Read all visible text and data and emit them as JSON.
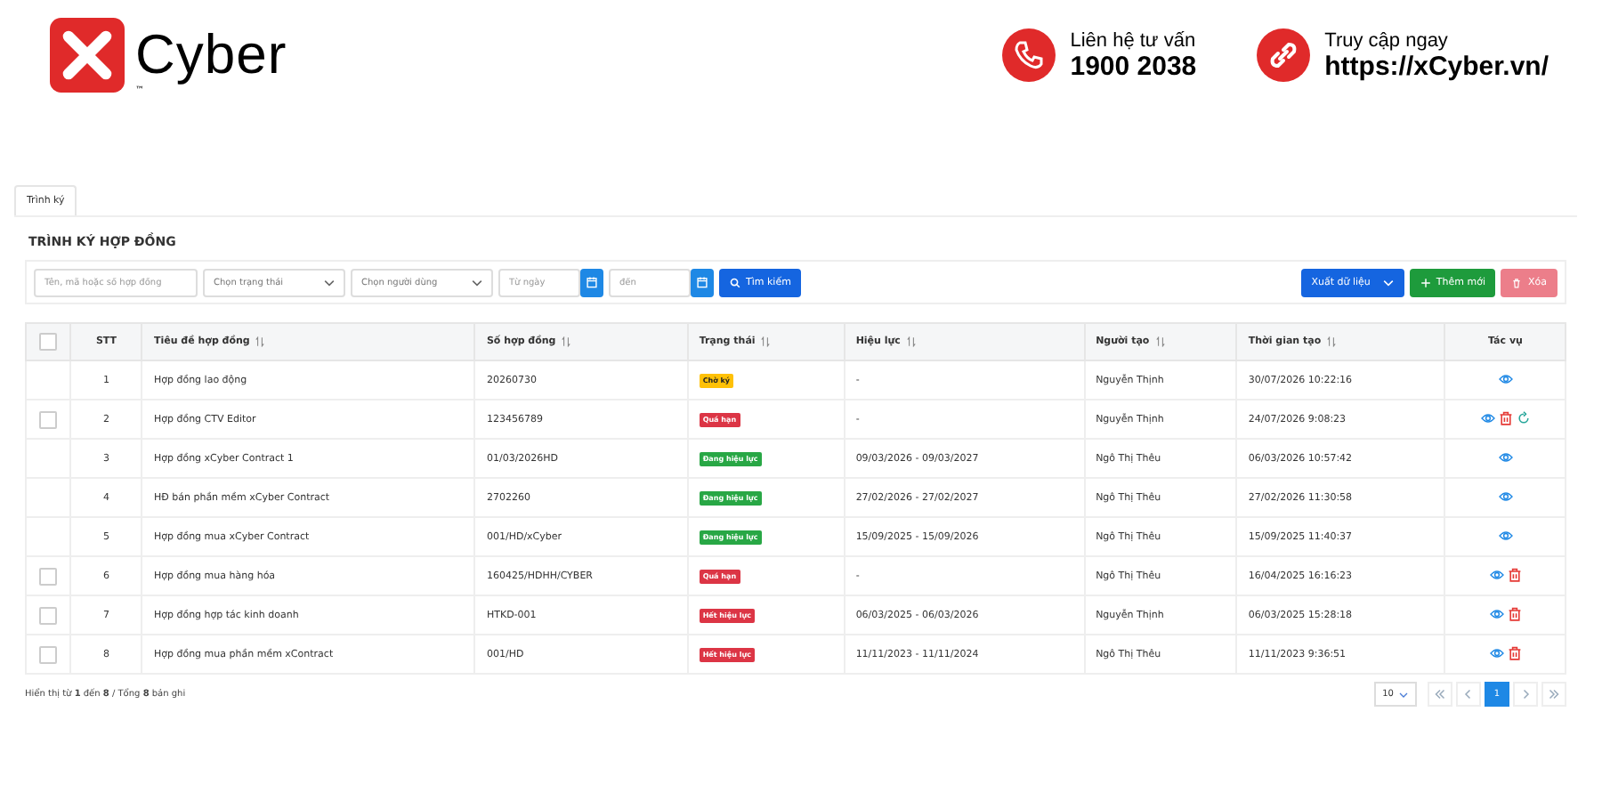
{
  "brand": {
    "name": "Cyber",
    "tm": "™"
  },
  "contacts": [
    {
      "kind": "phone",
      "label": "Liên hệ tư vấn",
      "value": "1900 2038"
    },
    {
      "kind": "link",
      "label": "Truy cập ngay",
      "value": "https://xCyber.vn/"
    }
  ],
  "tabs": [
    {
      "label": "Trình ký",
      "selected": true
    }
  ],
  "page_title": "TRÌNH KÝ HỢP ĐỒNG",
  "filters": {
    "search_placeholder": "Tên, mã hoặc số hợp đồng",
    "status_placeholder": "Chọn trạng thái",
    "user_placeholder": "Chọn người dùng",
    "from_placeholder": "Từ ngày",
    "to_placeholder": "đến",
    "search_button": "Tìm kiếm"
  },
  "toolbar": {
    "export": "Xuất dữ liệu",
    "add": "Thêm mới",
    "delete": "Xóa"
  },
  "table": {
    "select_all_checked": false,
    "columns": [
      {
        "label": "STT",
        "sortable": false
      },
      {
        "label": "Tiêu đề hợp đồng",
        "sortable": true
      },
      {
        "label": "Số hợp đồng",
        "sortable": true
      },
      {
        "label": "Trạng thái",
        "sortable": true
      },
      {
        "label": "Hiệu lực",
        "sortable": true
      },
      {
        "label": "Người tạo",
        "sortable": true
      },
      {
        "label": "Thời gian tạo",
        "sortable": true
      },
      {
        "label": "Tác vụ",
        "sortable": false
      }
    ],
    "rows": [
      {
        "stt": "1",
        "title": "Hợp đồng lao động",
        "number": "20260730",
        "status": "Chờ ký",
        "color": "#ffc107",
        "validity": "-",
        "creator": "Nguyễn Thịnh",
        "created": "30/07/2026 10:22:16",
        "deletable": false,
        "restorable": false
      },
      {
        "checked": false,
        "stt": "2",
        "title": "Hợp đồng CTV Editor",
        "number": "123456789",
        "status": "Quá hạn",
        "color": "#dc3545",
        "validity": "-",
        "creator": "Nguyễn Thịnh",
        "created": "24/07/2026 9:08:23",
        "deletable": true,
        "restorable": true
      },
      {
        "stt": "3",
        "title": "Hợp đồng xCyber Contract 1",
        "number": "01/03/2026HD",
        "status": "Đang hiệu lực",
        "color": "#28a745",
        "validity": "09/03/2026 - 09/03/2027",
        "creator": "Ngô Thị Thêu",
        "created": "06/03/2026 10:57:42",
        "deletable": false,
        "restorable": false
      },
      {
        "stt": "4",
        "title": "HĐ bán phần mềm xCyber Contract",
        "number": "2702260",
        "status": "Đang hiệu lực",
        "color": "#28a745",
        "validity": "27/02/2026 - 27/02/2027",
        "creator": "Ngô Thị Thêu",
        "created": "27/02/2026 11:30:58",
        "deletable": false,
        "restorable": false
      },
      {
        "stt": "5",
        "title": "Hợp đồng mua xCyber Contract",
        "number": "001/HD/xCyber",
        "status": "Đang hiệu lực",
        "color": "#28a745",
        "validity": "15/09/2025 - 15/09/2026",
        "creator": "Ngô Thị Thêu",
        "created": "15/09/2025 11:40:37",
        "deletable": false,
        "restorable": false
      },
      {
        "checked": false,
        "stt": "6",
        "title": "Hợp đồng mua hàng hóa",
        "number": "160425/HDHH/CYBER",
        "status": "Quá hạn",
        "color": "#dc3545",
        "validity": "-",
        "creator": "Ngô Thị Thêu",
        "created": "16/04/2025 16:16:23",
        "deletable": true,
        "restorable": false
      },
      {
        "checked": false,
        "stt": "7",
        "title": "Hợp đồng hợp tác kinh doanh",
        "number": "HTKD-001",
        "status": "Hết hiệu lực",
        "color": "#dc3545",
        "validity": "06/03/2025 - 06/03/2026",
        "creator": "Nguyễn Thịnh",
        "created": "06/03/2025 15:28:18",
        "deletable": true,
        "restorable": false
      },
      {
        "checked": false,
        "stt": "8",
        "title": "Hợp đồng mua phần mềm xContract",
        "number": "001/HD",
        "status": "Hết hiệu lực",
        "color": "#dc3545",
        "validity": "11/11/2023 - 11/11/2024",
        "creator": "Ngô Thị Thêu",
        "created": "11/11/2023 9:36:51",
        "deletable": true,
        "restorable": false
      }
    ]
  },
  "footer": {
    "summary": "Hiển thị từ **1** đến **8** / Tổng **8** bản ghi",
    "page_size": "10",
    "pages": [
      {
        "label": "1",
        "selected": true
      }
    ]
  }
}
